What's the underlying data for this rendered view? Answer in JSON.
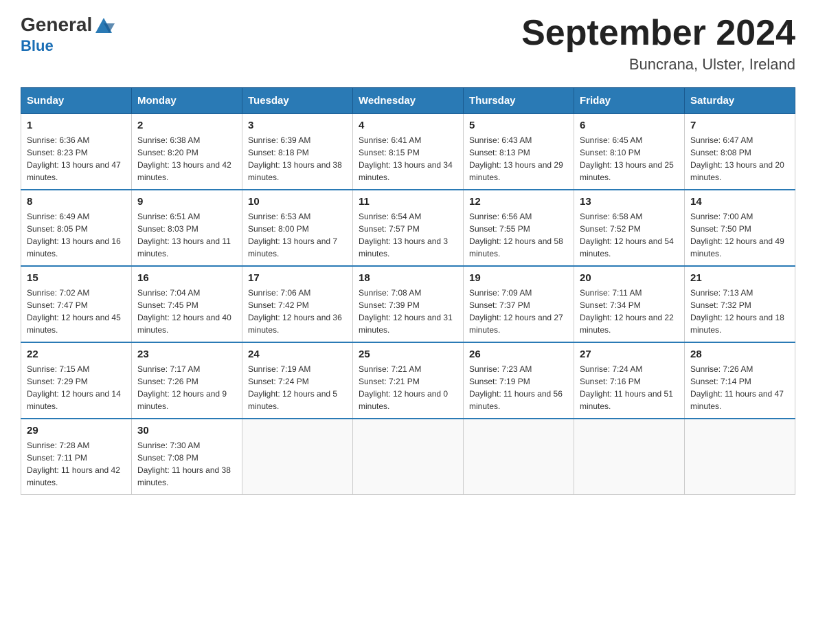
{
  "logo": {
    "general": "General",
    "blue": "Blue"
  },
  "header": {
    "month": "September 2024",
    "location": "Buncrana, Ulster, Ireland"
  },
  "weekdays": [
    "Sunday",
    "Monday",
    "Tuesday",
    "Wednesday",
    "Thursday",
    "Friday",
    "Saturday"
  ],
  "weeks": [
    [
      {
        "day": "1",
        "sunrise": "6:36 AM",
        "sunset": "8:23 PM",
        "daylight": "13 hours and 47 minutes."
      },
      {
        "day": "2",
        "sunrise": "6:38 AM",
        "sunset": "8:20 PM",
        "daylight": "13 hours and 42 minutes."
      },
      {
        "day": "3",
        "sunrise": "6:39 AM",
        "sunset": "8:18 PM",
        "daylight": "13 hours and 38 minutes."
      },
      {
        "day": "4",
        "sunrise": "6:41 AM",
        "sunset": "8:15 PM",
        "daylight": "13 hours and 34 minutes."
      },
      {
        "day": "5",
        "sunrise": "6:43 AM",
        "sunset": "8:13 PM",
        "daylight": "13 hours and 29 minutes."
      },
      {
        "day": "6",
        "sunrise": "6:45 AM",
        "sunset": "8:10 PM",
        "daylight": "13 hours and 25 minutes."
      },
      {
        "day": "7",
        "sunrise": "6:47 AM",
        "sunset": "8:08 PM",
        "daylight": "13 hours and 20 minutes."
      }
    ],
    [
      {
        "day": "8",
        "sunrise": "6:49 AM",
        "sunset": "8:05 PM",
        "daylight": "13 hours and 16 minutes."
      },
      {
        "day": "9",
        "sunrise": "6:51 AM",
        "sunset": "8:03 PM",
        "daylight": "13 hours and 11 minutes."
      },
      {
        "day": "10",
        "sunrise": "6:53 AM",
        "sunset": "8:00 PM",
        "daylight": "13 hours and 7 minutes."
      },
      {
        "day": "11",
        "sunrise": "6:54 AM",
        "sunset": "7:57 PM",
        "daylight": "13 hours and 3 minutes."
      },
      {
        "day": "12",
        "sunrise": "6:56 AM",
        "sunset": "7:55 PM",
        "daylight": "12 hours and 58 minutes."
      },
      {
        "day": "13",
        "sunrise": "6:58 AM",
        "sunset": "7:52 PM",
        "daylight": "12 hours and 54 minutes."
      },
      {
        "day": "14",
        "sunrise": "7:00 AM",
        "sunset": "7:50 PM",
        "daylight": "12 hours and 49 minutes."
      }
    ],
    [
      {
        "day": "15",
        "sunrise": "7:02 AM",
        "sunset": "7:47 PM",
        "daylight": "12 hours and 45 minutes."
      },
      {
        "day": "16",
        "sunrise": "7:04 AM",
        "sunset": "7:45 PM",
        "daylight": "12 hours and 40 minutes."
      },
      {
        "day": "17",
        "sunrise": "7:06 AM",
        "sunset": "7:42 PM",
        "daylight": "12 hours and 36 minutes."
      },
      {
        "day": "18",
        "sunrise": "7:08 AM",
        "sunset": "7:39 PM",
        "daylight": "12 hours and 31 minutes."
      },
      {
        "day": "19",
        "sunrise": "7:09 AM",
        "sunset": "7:37 PM",
        "daylight": "12 hours and 27 minutes."
      },
      {
        "day": "20",
        "sunrise": "7:11 AM",
        "sunset": "7:34 PM",
        "daylight": "12 hours and 22 minutes."
      },
      {
        "day": "21",
        "sunrise": "7:13 AM",
        "sunset": "7:32 PM",
        "daylight": "12 hours and 18 minutes."
      }
    ],
    [
      {
        "day": "22",
        "sunrise": "7:15 AM",
        "sunset": "7:29 PM",
        "daylight": "12 hours and 14 minutes."
      },
      {
        "day": "23",
        "sunrise": "7:17 AM",
        "sunset": "7:26 PM",
        "daylight": "12 hours and 9 minutes."
      },
      {
        "day": "24",
        "sunrise": "7:19 AM",
        "sunset": "7:24 PM",
        "daylight": "12 hours and 5 minutes."
      },
      {
        "day": "25",
        "sunrise": "7:21 AM",
        "sunset": "7:21 PM",
        "daylight": "12 hours and 0 minutes."
      },
      {
        "day": "26",
        "sunrise": "7:23 AM",
        "sunset": "7:19 PM",
        "daylight": "11 hours and 56 minutes."
      },
      {
        "day": "27",
        "sunrise": "7:24 AM",
        "sunset": "7:16 PM",
        "daylight": "11 hours and 51 minutes."
      },
      {
        "day": "28",
        "sunrise": "7:26 AM",
        "sunset": "7:14 PM",
        "daylight": "11 hours and 47 minutes."
      }
    ],
    [
      {
        "day": "29",
        "sunrise": "7:28 AM",
        "sunset": "7:11 PM",
        "daylight": "11 hours and 42 minutes."
      },
      {
        "day": "30",
        "sunrise": "7:30 AM",
        "sunset": "7:08 PM",
        "daylight": "11 hours and 38 minutes."
      },
      null,
      null,
      null,
      null,
      null
    ]
  ]
}
